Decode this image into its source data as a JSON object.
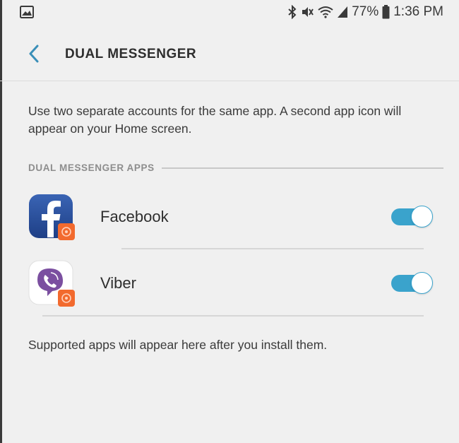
{
  "status_bar": {
    "battery": "77%",
    "time": "1:36 PM",
    "icons": [
      "gallery-icon",
      "bluetooth-icon",
      "mute-icon",
      "wifi-icon",
      "signal-icon",
      "battery-icon"
    ]
  },
  "header": {
    "back_icon": "chevron-left-icon",
    "title": "DUAL MESSENGER"
  },
  "description": "Use two separate accounts for the same app. A second app icon will appear on your Home screen.",
  "section": {
    "label": "DUAL MESSENGER APPS"
  },
  "apps": [
    {
      "name": "Facebook",
      "icon": "facebook-icon",
      "badge": "dual-badge-icon",
      "enabled": true
    },
    {
      "name": "Viber",
      "icon": "viber-icon",
      "badge": "dual-badge-icon",
      "enabled": true
    }
  ],
  "footer": "Supported apps will appear here after you install them.",
  "colors": {
    "accent": "#3aa3cc",
    "badge": "#f26a2e",
    "facebook": "#2a4f9c",
    "viber": "#7b4fa0"
  }
}
